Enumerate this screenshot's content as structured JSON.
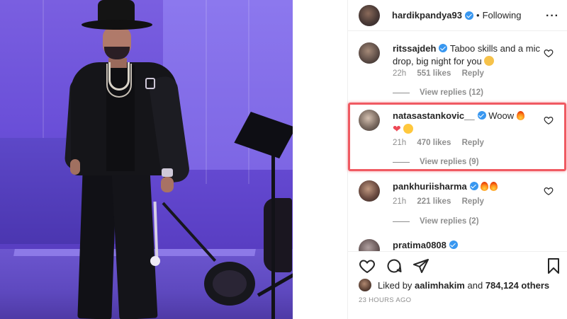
{
  "post_header": {
    "username": "hardikpandya93",
    "separator": "•",
    "follow_state": "Following",
    "more_label": "···"
  },
  "comments": [
    {
      "username": "ritssajdeh",
      "text": "Taboo skills and a mic drop, big night for you",
      "emoji": "clap",
      "time": "22h",
      "likes": "551 likes",
      "reply_label": "Reply",
      "view_replies": "View replies (12)"
    },
    {
      "username": "natasastankovic__",
      "text": "Woow",
      "time": "21h",
      "likes": "470 likes",
      "reply_label": "Reply",
      "view_replies": "View replies (9)"
    },
    {
      "username": "pankhuriisharma",
      "text": "",
      "time": "21h",
      "likes": "221 likes",
      "reply_label": "Reply",
      "view_replies": "View replies (2)"
    },
    {
      "username": "pratima0808",
      "text": ""
    }
  ],
  "actions": {
    "liked_by_prefix": "Liked by",
    "liked_by_user": "aalimhakim",
    "liked_by_and": "and",
    "liked_by_count": "784,124 others",
    "timestamp": "23 HOURS AGO"
  },
  "icons": [
    "heart-icon",
    "comment-icon",
    "share-icon",
    "bookmark-icon",
    "verified-icon",
    "more-icon"
  ],
  "colors": {
    "accent_blue": "#3897f0",
    "highlight_red": "#f05a62",
    "meta_gray": "#8e8e8e",
    "text": "#262626"
  }
}
